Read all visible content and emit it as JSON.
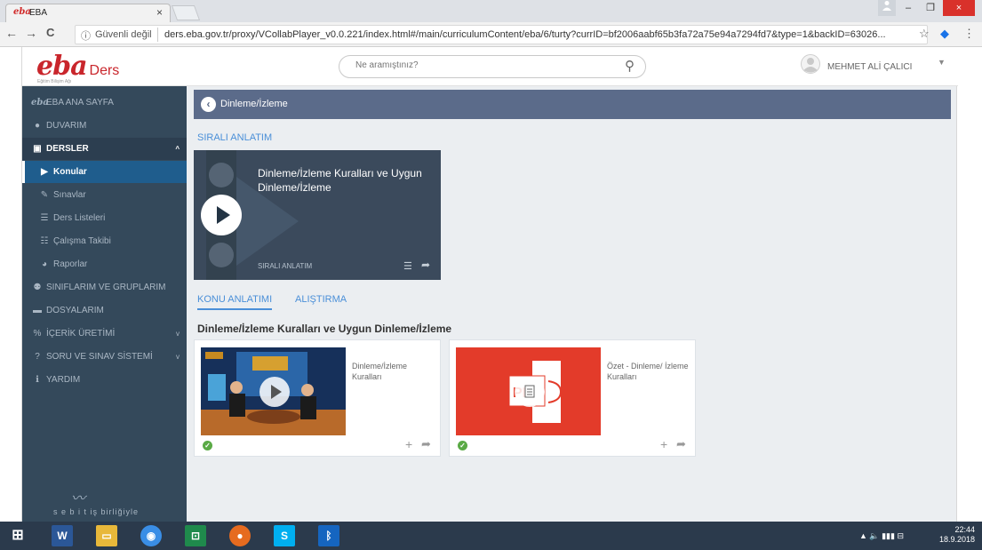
{
  "browser": {
    "tab_title": "EBA",
    "tab_favicon": "eba",
    "tab_close": "×",
    "security_label": "Güvenli değil",
    "url": "ders.eba.gov.tr/proxy/VCollabPlayer_v0.0.221/index.html#/main/curriculumContent/eba/6/turty?currID=bf2006aabf65b3fa72a75e94a7294fd7&type=1&backID=63026...",
    "nav_back": "←",
    "nav_forward": "→",
    "nav_reload": "C",
    "star": "☆",
    "menu": "⋮",
    "win_min": "–",
    "win_restore": "❐",
    "win_close": "×"
  },
  "header": {
    "logo_text": "eba",
    "logo_suffix": "Ders",
    "logo_tagline": "Eğitim Bilişim Ağı",
    "search_placeholder": "Ne aramıştınız?",
    "user_name": "MEHMET ALİ ÇALICI"
  },
  "sidebar": {
    "items": [
      {
        "label": "EBA ANA SAYFA",
        "icon": "eba-logo-icon"
      },
      {
        "label": "DUVARIM",
        "icon": "user-icon"
      },
      {
        "label": "DERSLER",
        "icon": "chalkboard-icon"
      },
      {
        "label": "Konular",
        "icon": "play-circle-icon"
      },
      {
        "label": "Sınavlar",
        "icon": "pencil-icon"
      },
      {
        "label": "Ders Listeleri",
        "icon": "list-icon"
      },
      {
        "label": "Çalışma Takibi",
        "icon": "search-list-icon"
      },
      {
        "label": "Raporlar",
        "icon": "pie-chart-icon"
      },
      {
        "label": "SINIFLARIM VE GRUPLARIM",
        "icon": "users-icon"
      },
      {
        "label": "DOSYALARIM",
        "icon": "folder-icon"
      },
      {
        "label": "İÇERİK ÜRETİMİ",
        "icon": "percent-icon"
      },
      {
        "label": "SORU VE SINAV SİSTEMİ",
        "icon": "question-icon"
      },
      {
        "label": "YARDIM",
        "icon": "info-icon"
      }
    ],
    "footer_text": "s e b i t  iş birliğiyle"
  },
  "main": {
    "header_title": "Dinleme/İzleme",
    "section_label": "SIRALI ANLATIM",
    "series": {
      "title": "Dinleme/İzleme Kuralları ve Uygun Dinleme/İzleme",
      "subtitle": "SIRALI ANLATIM"
    },
    "tabs": [
      {
        "label": "KONU ANLATIMI",
        "active": true
      },
      {
        "label": "ALIŞTIRMA",
        "active": false
      }
    ],
    "topic_title": "Dinleme/İzleme Kuralları ve Uygun Dinleme/İzleme",
    "cards": [
      {
        "title": "Dinleme/İzleme Kuralları",
        "type": "video"
      },
      {
        "title": "Özet - Dinleme/ İzleme Kuralları",
        "type": "pdf"
      }
    ]
  },
  "taskbar": {
    "time": "22:44",
    "date": "18.9.2018"
  },
  "colors": {
    "brand_red": "#c9262c",
    "sidebar_bg": "#34495b",
    "active_item": "#1f5d8d",
    "link_blue": "#4a8fd8",
    "content_header": "#5b6b8a"
  }
}
